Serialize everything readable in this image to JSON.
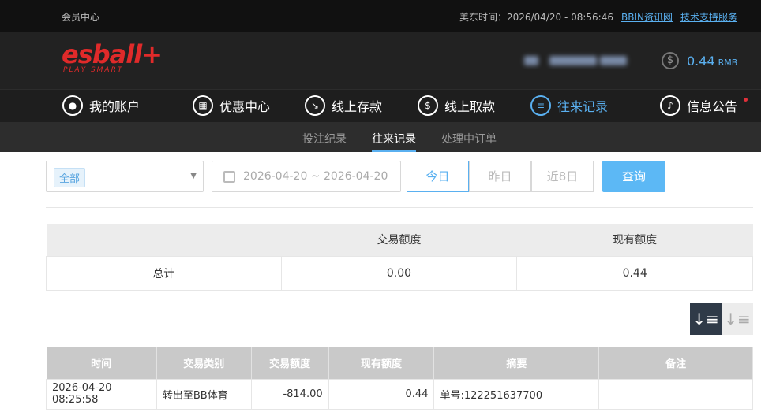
{
  "topbar": {
    "member_center": "会员中心",
    "time_text": "美东时间：2026/04/20 - 08:56:46",
    "link_news": "BBIN资讯网",
    "link_support": "技术支持服务"
  },
  "header": {
    "logo_text": "esball+",
    "logo_sub": "PLAY SMART",
    "balance": "0.44",
    "currency": "RMB",
    "coin_icon": "$"
  },
  "nav": {
    "items": [
      {
        "label": "我的账户",
        "icon": "user-icon"
      },
      {
        "label": "优惠中心",
        "icon": "gift-icon"
      },
      {
        "label": "线上存款",
        "icon": "deposit-icon"
      },
      {
        "label": "线上取款",
        "icon": "withdraw-icon"
      },
      {
        "label": "往来记录",
        "icon": "records-icon"
      },
      {
        "label": "信息公告",
        "icon": "bell-icon"
      }
    ],
    "active_index": 4
  },
  "subnav": {
    "items": [
      "投注纪录",
      "往来记录",
      "处理中订单"
    ],
    "active_index": 1
  },
  "filter": {
    "select_tag": "全部",
    "date_range": "2026-04-20 ~ 2026-04-20",
    "quick": [
      "今日",
      "昨日",
      "近8日"
    ],
    "quick_active": 0,
    "search_label": "查询"
  },
  "summary": {
    "headers": [
      "",
      "交易额度",
      "现有额度"
    ],
    "row": [
      "总计",
      "0.00",
      "0.44"
    ]
  },
  "records": {
    "headers": [
      "时间",
      "交易类别",
      "交易额度",
      "现有额度",
      "摘要",
      "备注"
    ],
    "rows": [
      [
        "2026-04-20 08:25:58",
        "转出至BB体育",
        "-814.00",
        "0.44",
        "单号:122251637700",
        ""
      ]
    ]
  },
  "colors": {
    "accent": "#5ab0f0",
    "logo_red": "#e02a2a",
    "dark_bg": "#222222"
  }
}
